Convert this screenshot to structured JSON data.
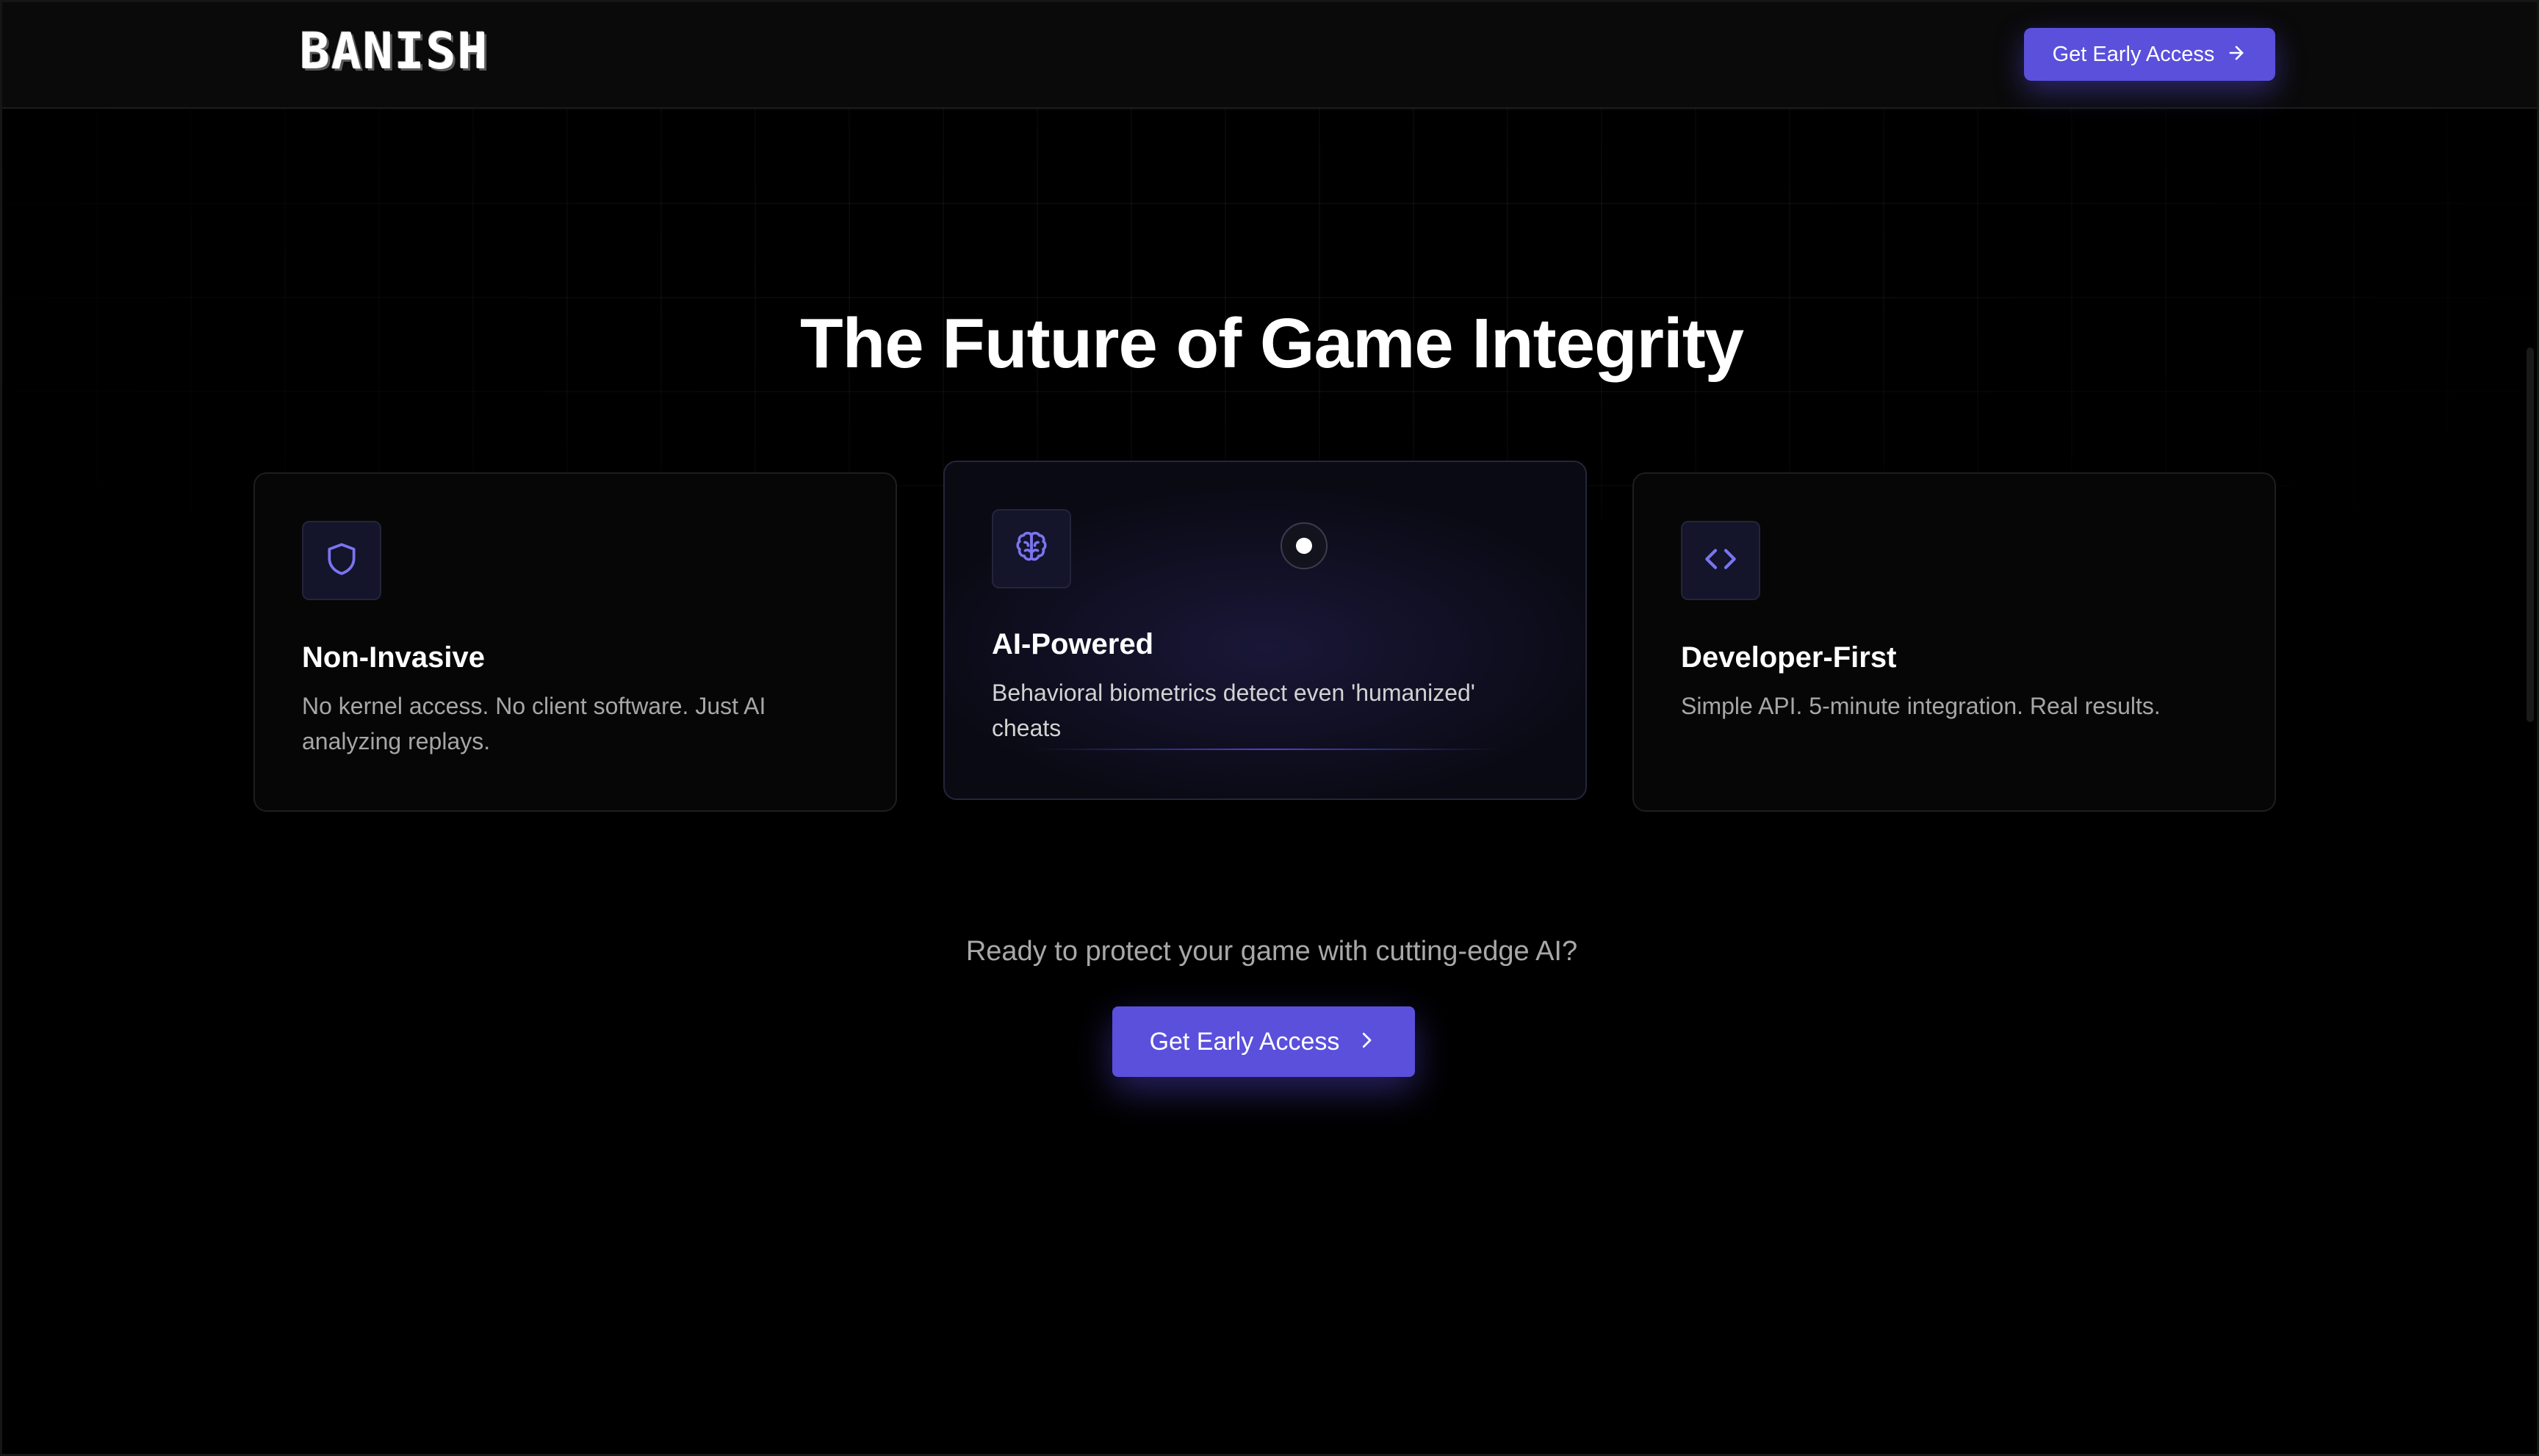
{
  "brand": {
    "logo_text": "BANISH"
  },
  "nav": {
    "cta_label": "Get Early Access",
    "cta_icon": "arrow-right-icon"
  },
  "hero": {
    "title": "The Future of Game Integrity"
  },
  "features": [
    {
      "icon": "shield-icon",
      "title": "Non-Invasive",
      "description": "No kernel access. No client software. Just AI analyzing replays."
    },
    {
      "icon": "brain-icon",
      "title": "AI-Powered",
      "description": "Behavioral biometrics detect even 'humanized' cheats"
    },
    {
      "icon": "code-icon",
      "title": "Developer-First",
      "description": "Simple API. 5-minute integration. Real results."
    }
  ],
  "cta": {
    "prompt": "Ready to protect your game with cutting-edge AI?",
    "button_label": "Get Early Access",
    "button_icon": "chevron-right-icon"
  },
  "colors": {
    "background": "#000000",
    "accent": "#5a50dc",
    "icon_accent": "#7b74f0",
    "muted_text": "#a6a6a6"
  }
}
